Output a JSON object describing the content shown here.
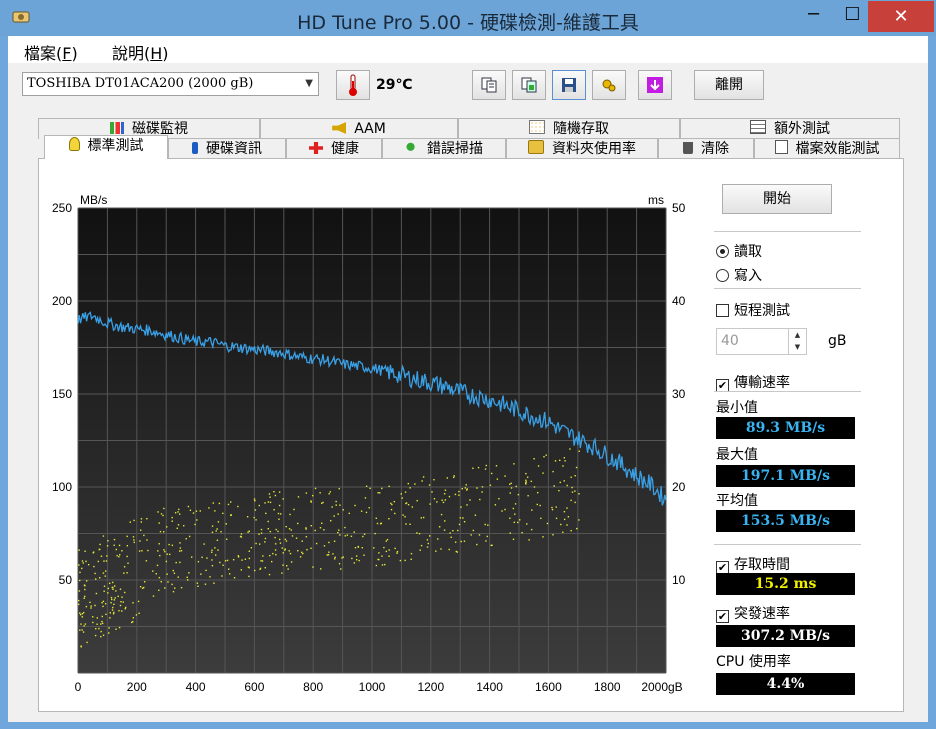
{
  "window": {
    "title": "HD Tune Pro  5.00 - 硬碟檢測-維護工具",
    "minimize": "─",
    "maximize": "☐",
    "close": "✕"
  },
  "menu": {
    "file_prefix": "檔案(",
    "file_key": "F",
    "file_suffix": ")",
    "help_prefix": "說明(",
    "help_key": "H",
    "help_suffix": ")"
  },
  "toolbar": {
    "drive": "TOSHIBA DT01ACA200 (2000 gB)",
    "temperature": "29℃",
    "exit_label": "離開"
  },
  "tabs_top": [
    "磁碟監視",
    "AAM",
    "隨機存取",
    "額外測試"
  ],
  "tabs_bottom": [
    "標準測試",
    "硬碟資訊",
    "健康",
    "錯誤掃描",
    "資料夾使用率",
    "清除",
    "檔案效能測試"
  ],
  "controls": {
    "start_label": "開始",
    "read_label": "讀取",
    "write_label": "寫入",
    "short_test_label": "短程測試",
    "short_test_value": "40",
    "short_test_unit": "gB",
    "transfer_label": "傳輸速率",
    "min_label": "最小值",
    "min_value": "89.3 MB/s",
    "max_label": "最大值",
    "max_value": "197.1 MB/s",
    "avg_label": "平均值",
    "avg_value": "153.5 MB/s",
    "access_label": "存取時間",
    "access_value": "15.2 ms",
    "burst_label": "突發速率",
    "burst_value": "307.2 MB/s",
    "cpu_label": "CPU 使用率",
    "cpu_value": "4.4%"
  },
  "colors": {
    "transfer_line": "#3aa0e6",
    "access_dots": "#e8e83a",
    "stat_blue": "#39b4f0",
    "stat_yellow": "#f0f000",
    "stat_white": "#ffffff",
    "plot_bg": "#1c1c1c"
  },
  "chart_data": {
    "type": "line",
    "xlabel": "",
    "ylabel": "MB/s",
    "y2label": "ms",
    "x_ticks": [
      "0",
      "200",
      "400",
      "600",
      "800",
      "1000",
      "1200",
      "1400",
      "1600",
      "1800",
      "2000gB"
    ],
    "y_ticks": [
      "50",
      "100",
      "150",
      "200",
      "250"
    ],
    "y2_ticks": [
      "10",
      "20",
      "30",
      "40",
      "50"
    ],
    "xlim": [
      0,
      2000
    ],
    "ylim": [
      0,
      250
    ],
    "y2lim": [
      0,
      50
    ],
    "grid": true,
    "series": [
      {
        "name": "傳輸速率",
        "axis": "left",
        "x": [
          0,
          50,
          100,
          150,
          200,
          250,
          300,
          350,
          400,
          450,
          500,
          550,
          600,
          650,
          700,
          750,
          800,
          850,
          900,
          950,
          1000,
          1050,
          1100,
          1150,
          1200,
          1250,
          1300,
          1350,
          1400,
          1450,
          1500,
          1550,
          1600,
          1650,
          1700,
          1750,
          1800,
          1850,
          1900,
          1950,
          2000
        ],
        "y": [
          190,
          192,
          188,
          186,
          185,
          184,
          182,
          180,
          178,
          178,
          176,
          175,
          174,
          173,
          172,
          170,
          169,
          168,
          166,
          165,
          164,
          162,
          160,
          158,
          156,
          154,
          151,
          149,
          147,
          144,
          141,
          138,
          135,
          130,
          126,
          122,
          117,
          112,
          106,
          101,
          93
        ]
      },
      {
        "name": "存取時間",
        "axis": "right",
        "type": "scatter",
        "x_range": [
          0,
          2000
        ],
        "y_trend": [
          [
            0,
            8
          ],
          [
            300,
            13
          ],
          [
            600,
            15
          ],
          [
            1000,
            16
          ],
          [
            1400,
            18
          ],
          [
            1700,
            20
          ]
        ]
      }
    ]
  }
}
